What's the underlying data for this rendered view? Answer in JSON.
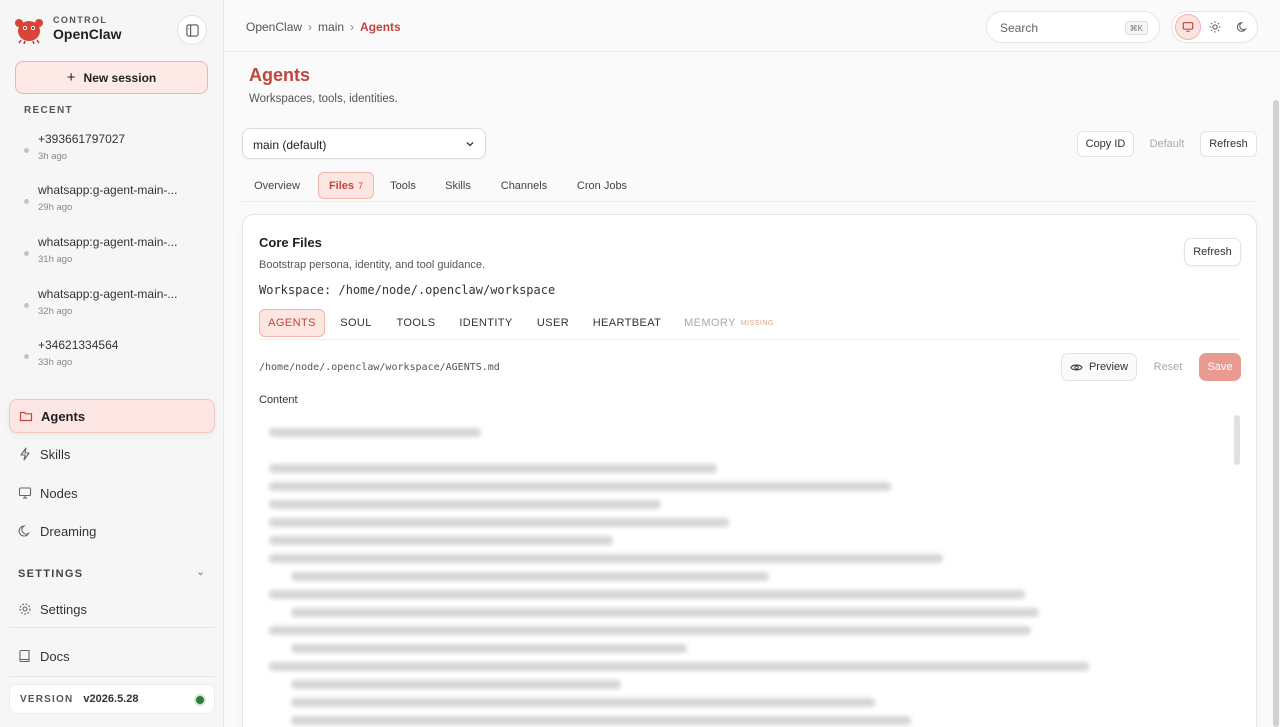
{
  "brand": {
    "small": "CONTROL",
    "name": "OpenClaw"
  },
  "sidebar": {
    "new_session": "New session",
    "recent_label": "RECENT",
    "recent": [
      {
        "title": "+393661797027",
        "time": "3h ago"
      },
      {
        "title": "whatsapp:g-agent-main-...",
        "time": "29h ago"
      },
      {
        "title": "whatsapp:g-agent-main-...",
        "time": "31h ago"
      },
      {
        "title": "whatsapp:g-agent-main-...",
        "time": "32h ago"
      },
      {
        "title": "+34621334564",
        "time": "33h ago"
      }
    ],
    "nav": [
      {
        "label": "Agents",
        "icon": "folder-icon"
      },
      {
        "label": "Skills",
        "icon": "lightning-icon"
      },
      {
        "label": "Nodes",
        "icon": "monitor-icon"
      },
      {
        "label": "Dreaming",
        "icon": "moon-icon"
      }
    ],
    "settings_label": "SETTINGS",
    "settings_item": "Settings",
    "docs_item": "Docs",
    "version_label": "VERSION",
    "version_value": "v2026.5.28"
  },
  "topbar": {
    "breadcrumbs": [
      "OpenClaw",
      "main",
      "Agents"
    ],
    "search_placeholder": "Search",
    "search_shortcut": "⌘K"
  },
  "page": {
    "title": "Agents",
    "subtitle": "Workspaces, tools, identities.",
    "agent_select": "main (default)",
    "buttons": {
      "copy_id": "Copy ID",
      "default": "Default",
      "refresh": "Refresh"
    },
    "tabs": [
      "Overview",
      "Files",
      "Tools",
      "Skills",
      "Channels",
      "Cron Jobs"
    ],
    "files_count": "7"
  },
  "card": {
    "title": "Core Files",
    "subtitle": "Bootstrap persona, identity, and tool guidance.",
    "workspace": "Workspace: /home/node/.openclaw/workspace",
    "refresh": "Refresh",
    "file_tabs": [
      "AGENTS",
      "SOUL",
      "TOOLS",
      "IDENTITY",
      "USER",
      "HEARTBEAT",
      "MEMORY"
    ],
    "missing_label": "MISSING",
    "path": "/home/node/.openclaw/workspace/AGENTS.md",
    "preview": "Preview",
    "reset": "Reset",
    "save": "Save",
    "content_label": "Content"
  },
  "colors": {
    "accent": "#c2453c",
    "accent_soft": "#fde6e2",
    "save": "#e99a91",
    "online": "#2e7d3a"
  }
}
